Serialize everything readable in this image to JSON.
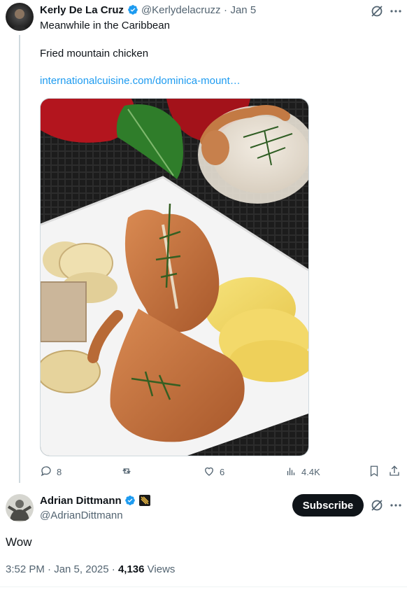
{
  "tweet1": {
    "display_name": "Kerly De La Cruz",
    "handle": "@Kerlydelacruzz",
    "separator": "·",
    "date": "Jan 5",
    "line1": "Meanwhile in the Caribbean",
    "line2": "Fried mountain chicken",
    "link": "internationalcuisine.com/dominica-mount…",
    "actions": {
      "replies": "8",
      "reposts": "",
      "likes": "6",
      "views": "4.4K"
    },
    "icons": [
      "grok-icon",
      "more-icon",
      "reply-icon",
      "repost-icon",
      "like-icon",
      "views-icon",
      "bookmark-icon",
      "share-icon"
    ]
  },
  "tweet2": {
    "display_name": "Adrian Dittmann",
    "handle": "@AdrianDittmann",
    "subscribe_label": "Subscribe",
    "text": "Wow",
    "time": "3:52 PM · Jan 5, 2025 ·",
    "views_count": "4,136",
    "views_label": "Views"
  },
  "colors": {
    "link": "#1d9bf0",
    "muted": "#536471",
    "text": "#0f1419",
    "verified": "#1d9bf0"
  }
}
